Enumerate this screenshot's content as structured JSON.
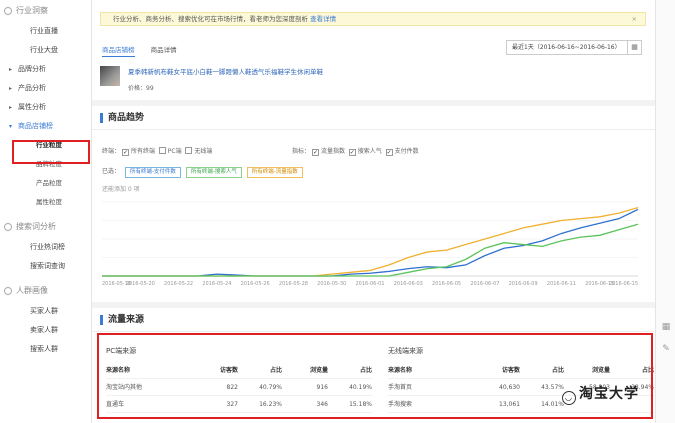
{
  "sidebar": {
    "sec1": "行业洞察",
    "items1": [
      "行业直播",
      "行业大盘"
    ],
    "groups": [
      "品牌分析",
      "产品分析",
      "属性分析"
    ],
    "open_group": "商品店铺榜",
    "subs": [
      "行业粒度",
      "品牌粒度",
      "产品粒度",
      "属性粒度"
    ],
    "sec2": "搜索词分析",
    "items2": [
      "行业热词榜",
      "搜索词查询"
    ],
    "sec3": "人群画像",
    "items3": [
      "买家人群",
      "卖家人群",
      "搜索人群"
    ]
  },
  "notice": {
    "text": "行业分析、商务分析、搜索优化可在市场行情，看老师为您深度剖析",
    "link": "查看详情",
    "close": "×"
  },
  "tabs": [
    "商品店铺榜",
    "商品详情"
  ],
  "date_range": "最近1天（2016-06-16~2016-06-16）",
  "product": {
    "title": "夏季韩新帆布鞋女平底小白鞋一脚蹬懒人鞋透气乐福鞋学生休闲单鞋",
    "price": "价格：99"
  },
  "trend": {
    "title": "商品趋势",
    "terminal_label": "终端：",
    "terminals": [
      {
        "label": "所有终端",
        "checked": true
      },
      {
        "label": "PC端",
        "checked": false
      },
      {
        "label": "无线端",
        "checked": false
      }
    ],
    "metric_label": "指标：",
    "metrics": [
      {
        "label": "流量指数",
        "checked": true
      },
      {
        "label": "搜索人气",
        "checked": true
      },
      {
        "label": "支付件数",
        "checked": true
      }
    ],
    "selected_label": "已选：",
    "chips": [
      "所有终端-支付件数",
      "所有终端-搜索人气",
      "所有终端-流量指数"
    ],
    "compare": "还能添加 0 项",
    "colors": {
      "blue": "#2f6fcf",
      "green": "#5cc35c",
      "orange": "#f0b030"
    }
  },
  "chart_data": {
    "type": "line",
    "x": [
      "2016-05-19",
      "2016-05-20",
      "2016-05-21",
      "2016-05-22",
      "2016-05-23",
      "2016-05-24",
      "2016-05-25",
      "2016-05-26",
      "2016-05-27",
      "2016-05-28",
      "2016-05-29",
      "2016-05-30",
      "2016-05-31",
      "2016-06-01",
      "2016-06-02",
      "2016-06-03",
      "2016-06-04",
      "2016-06-05",
      "2016-06-06",
      "2016-06-07",
      "2016-06-08",
      "2016-06-09",
      "2016-06-10",
      "2016-06-11",
      "2016-06-12",
      "2016-06-13",
      "2016-06-14",
      "2016-06-15",
      "2016-06-16"
    ],
    "tick_labels": [
      "2016-05-18",
      "2016-05-20",
      "2016-05-22",
      "2016-05-24",
      "2016-05-26",
      "2016-05-28",
      "2016-05-30",
      "2016-06-01",
      "2016-06-03",
      "2016-06-05",
      "2016-06-07",
      "2016-06-09",
      "2016-06-11",
      "2016-06-13",
      "2016-06-15"
    ],
    "series": [
      {
        "color": "#2f6fcf",
        "values": [
          0,
          0,
          0,
          0,
          0,
          0,
          2,
          1,
          0,
          0,
          0,
          0,
          0,
          2,
          3,
          5,
          8,
          10,
          9,
          12,
          22,
          30,
          33,
          38,
          46,
          52,
          57,
          62,
          72
        ]
      },
      {
        "color": "#f0b030",
        "values": [
          0,
          0,
          0,
          0,
          0,
          0,
          0,
          0,
          0,
          0,
          0,
          0,
          2,
          4,
          6,
          12,
          20,
          26,
          28,
          34,
          40,
          46,
          52,
          56,
          60,
          62,
          64,
          68,
          74
        ]
      },
      {
        "color": "#5cc35c",
        "values": [
          0,
          0,
          0,
          0,
          0,
          0,
          0,
          0,
          0,
          0,
          0,
          0,
          0,
          0,
          0,
          0,
          4,
          8,
          10,
          18,
          30,
          36,
          34,
          32,
          38,
          42,
          44,
          50,
          56
        ]
      }
    ],
    "ylim": [
      0,
      80
    ]
  },
  "traffic": {
    "title": "流量来源",
    "pc": {
      "title": "PC端来源",
      "headers": [
        "来源名称",
        "访客数",
        "占比",
        "浏览量",
        "占比"
      ],
      "rows": [
        [
          "淘宝站内其他",
          "822",
          "40.79%",
          "916",
          "40.19%"
        ],
        [
          "直通车",
          "327",
          "16.23%",
          "346",
          "15.18%"
        ]
      ]
    },
    "mobile": {
      "title": "无线端来源",
      "headers": [
        "来源名称",
        "访客数",
        "占比",
        "浏览量",
        "占比"
      ],
      "rows": [
        [
          "手淘首页",
          "40,630",
          "43.57%",
          "58,803",
          "38.94%"
        ],
        [
          "手淘搜索",
          "13,061",
          "14.01%",
          "",
          ""
        ]
      ]
    }
  },
  "watermark": "淘宝大学"
}
